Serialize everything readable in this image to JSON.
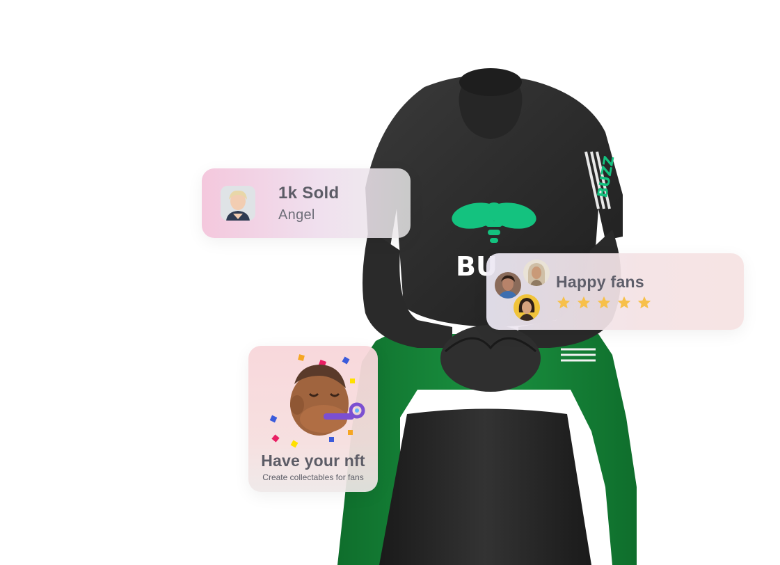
{
  "colors": {
    "shirt": "#2b2b2b",
    "pants": "#17853a",
    "brand_green": "#14c27f",
    "star": "#f7c04a"
  },
  "shirt": {
    "chest_text": "BU",
    "sleeve_text": "BUZZ"
  },
  "sold_card": {
    "title": "1k Sold",
    "name": "Angel",
    "avatar_icon": "user-photo"
  },
  "fans_card": {
    "title": "Happy fans",
    "rating": 5,
    "avatar_icons": [
      "fan-photo",
      "fan-photo",
      "fan-photo"
    ]
  },
  "nft_card": {
    "title": "Have your nft",
    "subtitle": "Create collectables for fans",
    "emoji_icon": "party-face-emoji"
  }
}
